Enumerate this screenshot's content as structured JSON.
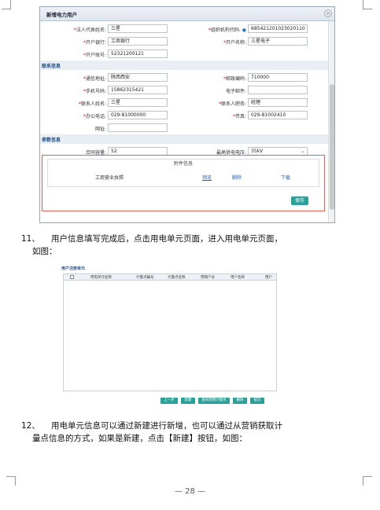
{
  "dialog": {
    "title": "新增电力用户",
    "close_glyph": "×",
    "fields_top": [
      {
        "label": "法人代表姓名:",
        "value": "三星",
        "required": true
      },
      {
        "label": "组织机构代码:",
        "value": "685421201023020110",
        "required": true
      },
      {
        "label": "开户银行:",
        "value": "工商银行",
        "required": true
      },
      {
        "label": "开户名称:",
        "value": "三星电子",
        "required": true
      },
      {
        "label": "开户账号:",
        "value": "52321200121",
        "required": true
      }
    ],
    "section_contact": "联系信息",
    "fields_contact": [
      {
        "label": "通信地址:",
        "value": "陕西西安",
        "required": true
      },
      {
        "label": "邮政编码:",
        "value": "710000",
        "required": true
      },
      {
        "label": "手机号码:",
        "value": "15862315421",
        "required": true
      },
      {
        "label": "电子邮件:",
        "value": "",
        "required": false
      },
      {
        "label": "联系人姓名:",
        "value": "三星",
        "required": true
      },
      {
        "label": "联系人职务:",
        "value": "经理",
        "required": true
      },
      {
        "label": "办公电话:",
        "value": "029-81000000",
        "required": true
      },
      {
        "label": "传真:",
        "value": "029-81002410",
        "required": true
      },
      {
        "label": "网址:",
        "value": "",
        "required": false
      }
    ],
    "section_param": "参数信息",
    "capacity_label": "合同容量:",
    "capacity_value": "52",
    "voltage_label": "最高供电电压:",
    "voltage_value": "35kV",
    "attachment": {
      "header": "附件信息",
      "name": "工商营业执照",
      "preview": "预览",
      "delete": "删除",
      "download": "下载"
    },
    "save_label": "保存"
  },
  "para11": {
    "num": "11、",
    "line1": "用户信息填写完成后，点击用电单元页面，进入用电单元页面，",
    "line2": "如图："
  },
  "unit_panel": {
    "title": "用户注册单元",
    "columns": [
      "用电单元名称",
      "计量点编号",
      "计量点名称",
      "营销户号",
      "用户名称",
      "用户"
    ],
    "buttons": [
      "上一步",
      "新建",
      "查询营销计量点",
      "删除",
      "提交"
    ]
  },
  "para12": {
    "num": "12、",
    "line1": "用电单元信息可以通过新建进行新增，也可以通过从营销获取计",
    "line2": "量点信息的方式，如果是新建，点击【新建】按钮，如图："
  },
  "page_number": "— 28 —",
  "colors": {
    "accent": "#2aa198",
    "required": "#dd0000",
    "section": "#1f4e86",
    "attach_border": "#e06060"
  }
}
